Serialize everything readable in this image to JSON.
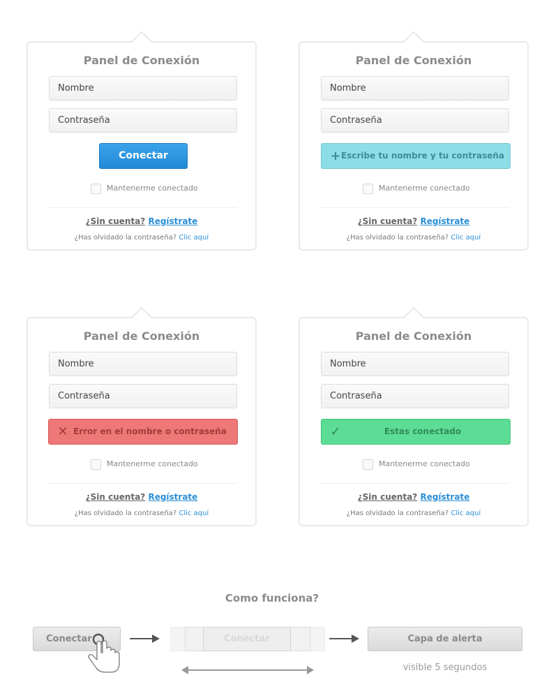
{
  "panel": {
    "title": "Panel de Conexión",
    "username_placeholder": "Nombre",
    "password_placeholder": "Contraseña",
    "remember_label": "Mantenerme conectado",
    "signup_question": "¿Sin cuenta?",
    "signup_link": "Regístrate",
    "forgot_text": "¿Has olvidado la contraseña?",
    "forgot_link": "Clic aquí"
  },
  "states": [
    {
      "variant": "default",
      "button_label": "Conectar",
      "icon": ""
    },
    {
      "variant": "info",
      "button_label": "Escribe tu nombre y tu contraseña",
      "icon": "plus-icon"
    },
    {
      "variant": "error",
      "button_label": "Error en el nombre o contraseña",
      "icon": "x-icon"
    },
    {
      "variant": "success",
      "button_label": "Estas conectado",
      "icon": "check-icon"
    }
  ],
  "how_it_works": {
    "title": "Como funciona?",
    "step1_label": "Conectar",
    "step2_label": "Conectar",
    "step3_label": "Capa de alerta",
    "step3_note": "visible 5 segundos"
  },
  "colors": {
    "connect": "#2b93e0",
    "info": "#8ddde7",
    "error": "#ee7777",
    "success": "#5ddc95",
    "link": "#2b8fd6"
  }
}
